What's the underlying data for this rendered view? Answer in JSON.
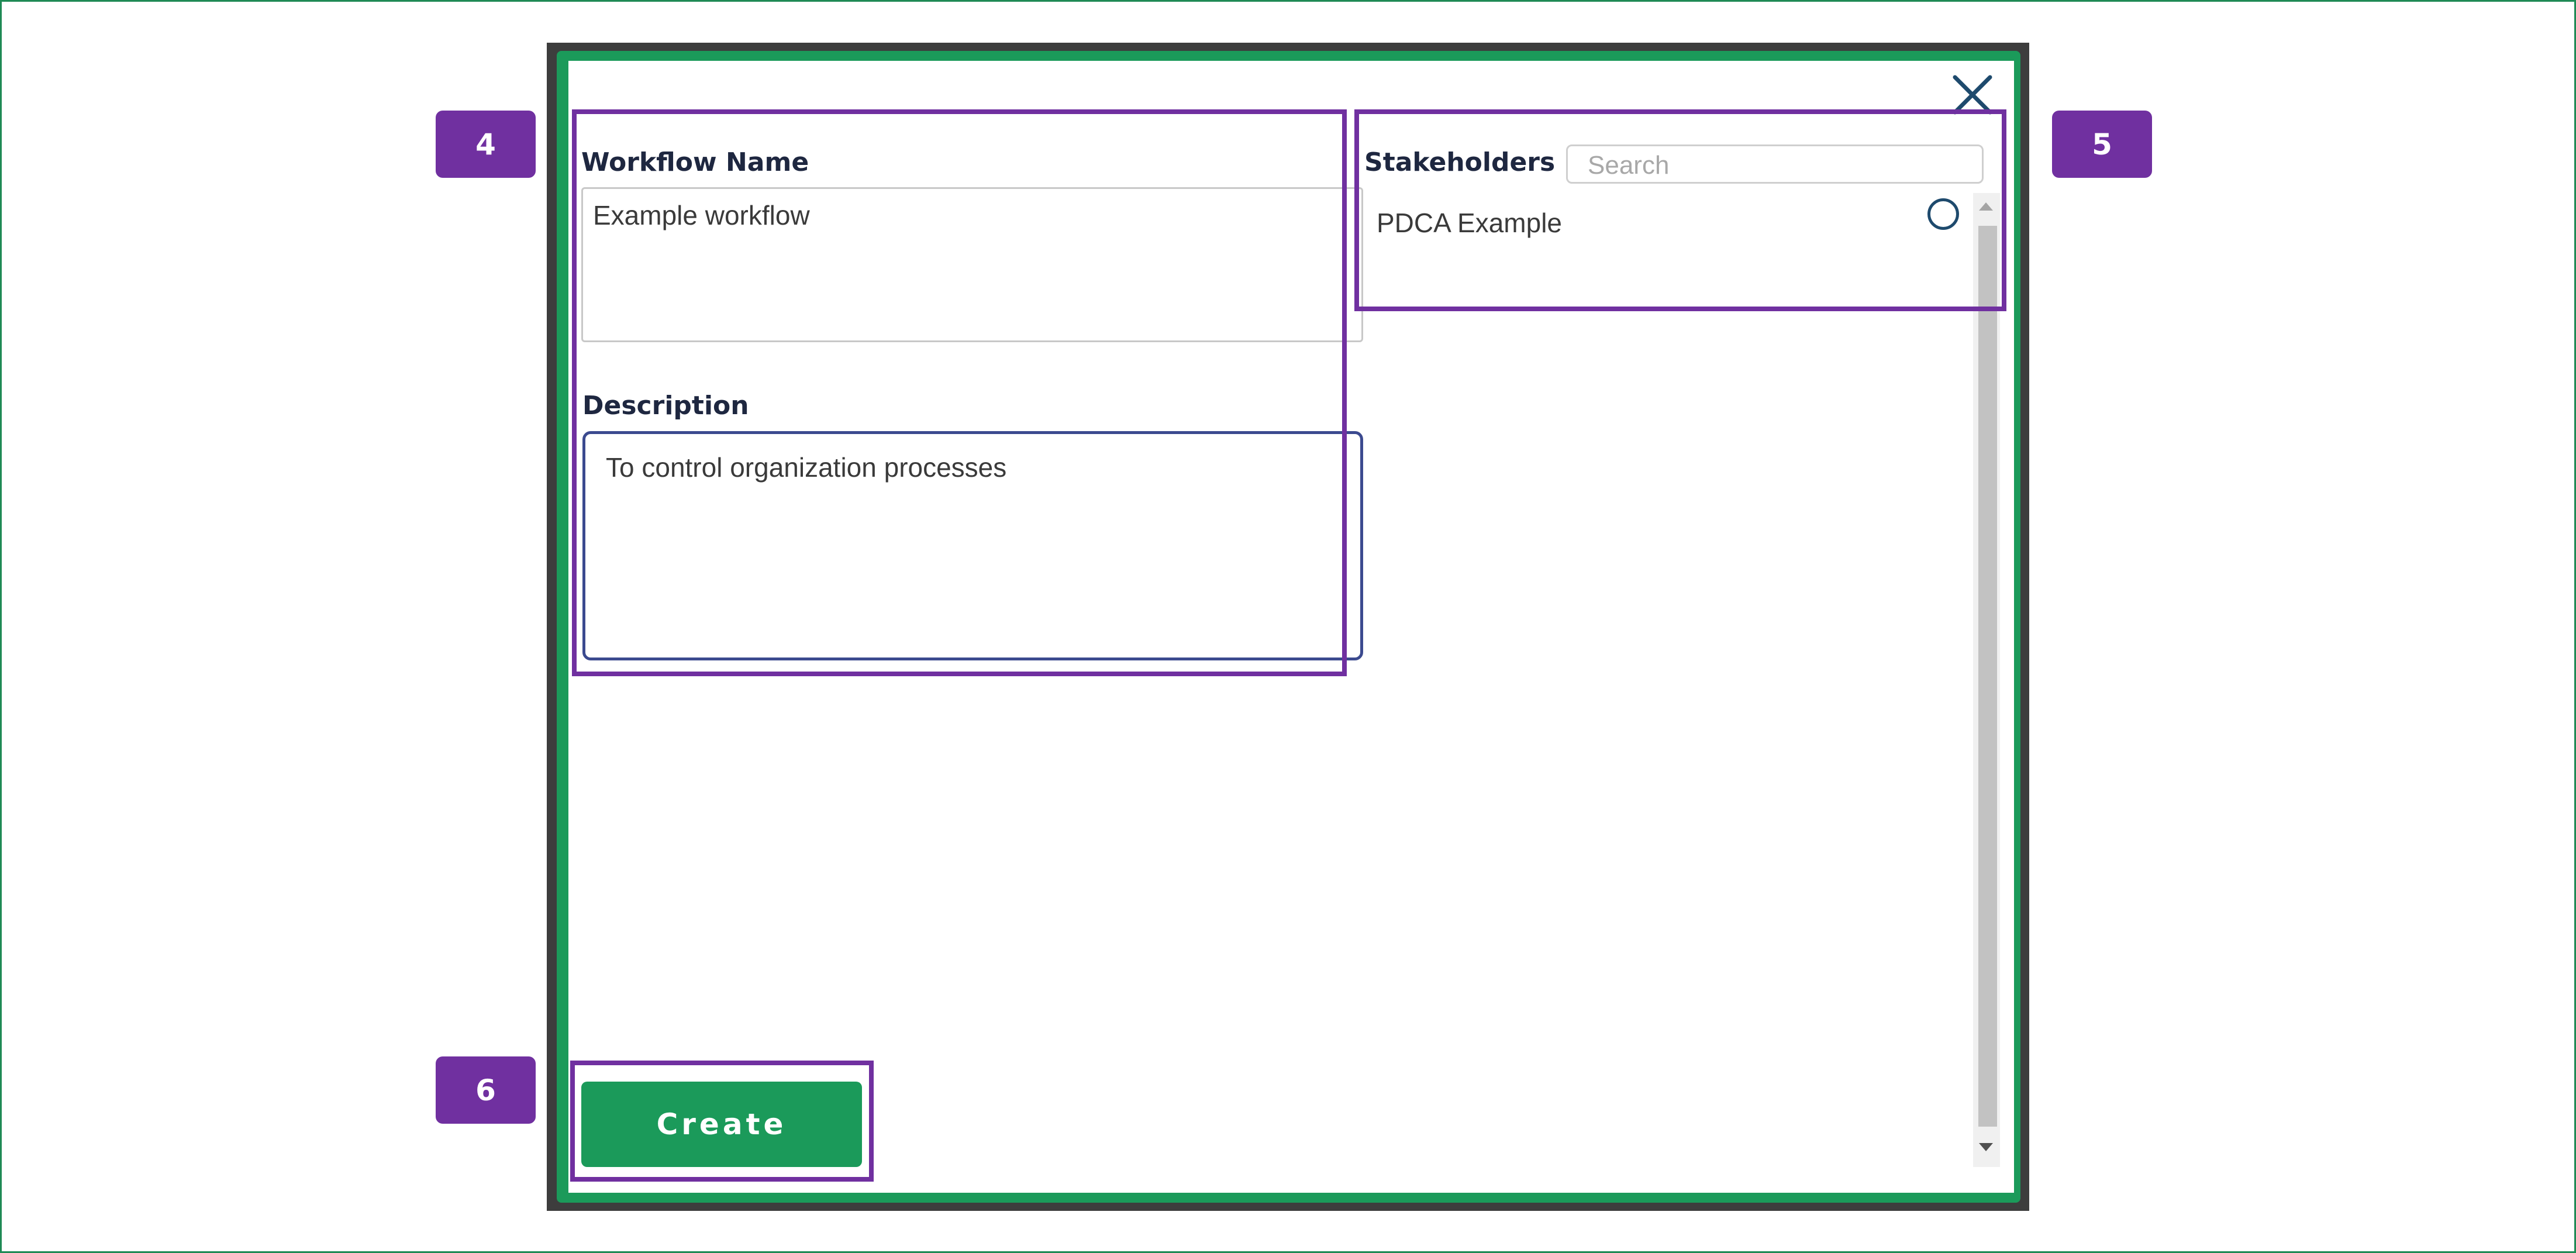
{
  "dialog": {
    "workflow_name_label": "Workflow Name",
    "workflow_name_value": "Example workflow",
    "description_label": "Description",
    "description_value": "To control organization processes",
    "stakeholders_label": "Stakeholders",
    "search_placeholder": "Search",
    "stakeholders": [
      {
        "name": "PDCA Example",
        "selected": false
      }
    ],
    "create_label": "Create",
    "close_icon": "close-icon"
  },
  "callouts": [
    "4",
    "5",
    "6"
  ],
  "colors": {
    "accent_green": "#1b9a5a",
    "callout_purple": "#7030a0",
    "label_navy": "#1e2740"
  }
}
